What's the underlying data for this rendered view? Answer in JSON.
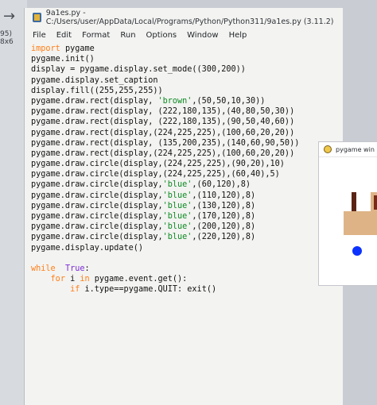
{
  "background": {
    "partial_text": "95) 8x6",
    "back_arrow_icon": "arrow-left-icon"
  },
  "editor": {
    "title": "9a1es.py - C:/Users/user/AppData/Local/Programs/Python/Python311/9a1es.py (3.11.2)",
    "menu": [
      "File",
      "Edit",
      "Format",
      "Run",
      "Options",
      "Window",
      "Help"
    ],
    "code_lines": [
      "import pygame",
      "pygame.init()",
      "display = pygame.display.set_mode((300,200))",
      "pygame.display.set_caption",
      "display.fill((255,255,255))",
      "pygame.draw.rect(display, 'brown',(50,50,10,30))",
      "pygame.draw.rect(display, (222,180,135),(40,80,50,30))",
      "pygame.draw.rect(display, (222,180,135),(90,50,40,60))",
      "pygame.draw.rect(display,(224,225,225),(100,60,20,20))",
      "pygame.draw.rect(display, (135,200,235),(140,60,90,50))",
      "pygame.draw.rect(display,(224,225,225),(100,60,20,20))",
      "pygame.draw.circle(display,(224,225,225),(90,20),10)",
      "pygame.draw.circle(display,(224,225,225),(60,40),5)",
      "pygame.draw.circle(display,'blue',(60,120),8)",
      "pygame.draw.circle(display,'blue',(110,120),8)",
      "pygame.draw.circle(display,'blue',(130,120),8)",
      "pygame.draw.circle(display,'blue',(170,120),8)",
      "pygame.draw.circle(display,'blue',(200,120),8)",
      "pygame.draw.circle(display,'blue',(220,120),8)",
      "pygame.display.update()",
      "",
      "while  True:",
      "    for i in pygame.event.get():",
      "        if i.type==pygame.QUIT: exit()"
    ]
  },
  "pygame_window": {
    "title": "pygame win",
    "icon": "pygame-icon"
  }
}
